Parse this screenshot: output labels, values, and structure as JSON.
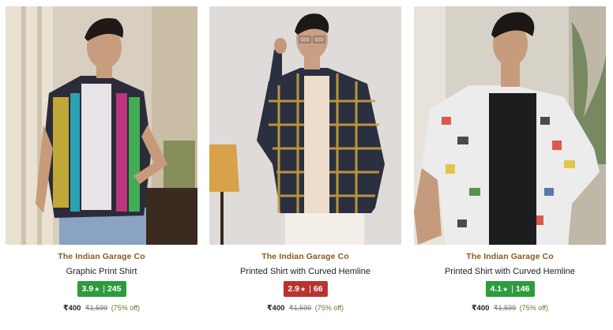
{
  "products": [
    {
      "brand": "The Indian Garage Co",
      "name": "Graphic Print Shirt",
      "rating": "3.9",
      "star": "★",
      "reviews": "245",
      "rating_color": "#2e9b3e",
      "price": "₹400",
      "mrp": "₹1,599",
      "discount": "(75% off)"
    },
    {
      "brand": "The Indian Garage Co",
      "name": "Printed Shirt with Curved Hemline",
      "rating": "2.9",
      "star": "★",
      "reviews": "66",
      "rating_color": "#b8332f",
      "price": "₹400",
      "mrp": "₹1,599",
      "discount": "(75% off)"
    },
    {
      "brand": "The Indian Garage Co",
      "name": "Printed Shirt with Curved Hemline",
      "rating": "4.1",
      "star": "★",
      "reviews": "146",
      "rating_color": "#2e9b3e",
      "price": "₹400",
      "mrp": "₹1,599",
      "discount": "(75% off)"
    }
  ]
}
